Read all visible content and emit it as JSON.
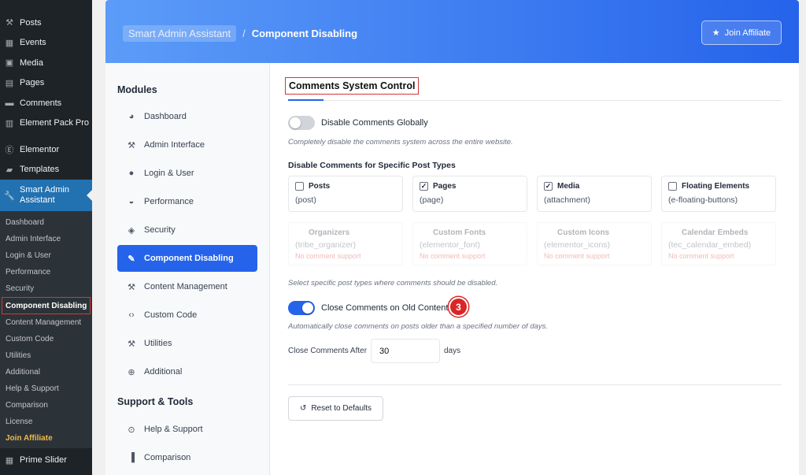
{
  "wp_menu": {
    "items": [
      {
        "label": "Posts",
        "icon": "pin-icon"
      },
      {
        "label": "Events",
        "icon": "calendar-icon"
      },
      {
        "label": "Media",
        "icon": "media-icon"
      },
      {
        "label": "Pages",
        "icon": "pages-icon"
      },
      {
        "label": "Comments",
        "icon": "comments-icon"
      },
      {
        "label": "Element Pack Pro",
        "icon": "element-pack-icon"
      }
    ],
    "items2": [
      {
        "label": "Elementor",
        "icon": "elementor-icon"
      },
      {
        "label": "Templates",
        "icon": "templates-icon"
      }
    ],
    "active": {
      "label1": "Smart Admin",
      "label2": "Assistant",
      "icon": "wrench-icon"
    },
    "submenu": [
      "Dashboard",
      "Admin Interface",
      "Login & User",
      "Performance",
      "Security",
      "Component Disabling",
      "Content Management",
      "Custom Code",
      "Utilities",
      "Additional",
      "Help & Support",
      "Comparison",
      "License",
      "Join Affiliate"
    ],
    "bottom": {
      "label": "Prime Slider",
      "icon": "slider-icon"
    }
  },
  "header": {
    "breadcrumb_root": "Smart Admin Assistant",
    "separator": "/",
    "breadcrumb_current": "Component Disabling",
    "affiliate_button": "Join Affiliate"
  },
  "modules_nav": {
    "title": "Modules",
    "items": [
      {
        "label": "Dashboard",
        "icon": "palette-icon"
      },
      {
        "label": "Admin Interface",
        "icon": "pin-icon"
      },
      {
        "label": "Login & User",
        "icon": "user-icon"
      },
      {
        "label": "Performance",
        "icon": "gauge-icon"
      },
      {
        "label": "Security",
        "icon": "shield-icon"
      },
      {
        "label": "Component Disabling",
        "icon": "brush-icon"
      },
      {
        "label": "Content Management",
        "icon": "pin-icon"
      },
      {
        "label": "Custom Code",
        "icon": "code-icon"
      },
      {
        "label": "Utilities",
        "icon": "wrench-icon"
      },
      {
        "label": "Additional",
        "icon": "plus-circle-icon"
      }
    ],
    "support_title": "Support & Tools",
    "support_items": [
      {
        "label": "Help & Support",
        "icon": "lifebuoy-icon"
      },
      {
        "label": "Comparison",
        "icon": "bar-chart-icon"
      }
    ]
  },
  "main": {
    "section_title": "Comments System Control",
    "disable_globally": {
      "label": "Disable Comments Globally",
      "enabled": false,
      "help": "Completely disable the comments system across the entire website."
    },
    "post_types_title": "Disable Comments for Specific Post Types",
    "post_types": [
      {
        "label": "Posts",
        "slug": "(post)",
        "checked": false
      },
      {
        "label": "Pages",
        "slug": "(page)",
        "checked": true
      },
      {
        "label": "Media",
        "slug": "(attachment)",
        "checked": true
      },
      {
        "label": "Floating Elements",
        "slug": "(e-floating-buttons)",
        "checked": false
      }
    ],
    "unsupported_types": [
      {
        "label": "Organizers",
        "slug": "(tribe_organizer)",
        "note": "No comment support"
      },
      {
        "label": "Custom Fonts",
        "slug": "(elementor_font)",
        "note": "No comment support"
      },
      {
        "label": "Custom Icons",
        "slug": "(elementor_icons)",
        "note": "No comment support"
      },
      {
        "label": "Calendar Embeds",
        "slug": "(tec_calendar_embed)",
        "note": "No comment support"
      }
    ],
    "post_types_help": "Select specific post types where comments should be disabled.",
    "close_old": {
      "label": "Close Comments on Old Content",
      "enabled": true,
      "help": "Automatically close comments on posts older than a specified number of days."
    },
    "close_after": {
      "label": "Close Comments After",
      "value": "30",
      "unit": "days"
    },
    "step_badge": "3",
    "reset_button": "Reset to Defaults"
  },
  "colors": {
    "accent": "#2563eb",
    "wp_sidebar": "#1d2327",
    "highlight": "#d63638"
  }
}
